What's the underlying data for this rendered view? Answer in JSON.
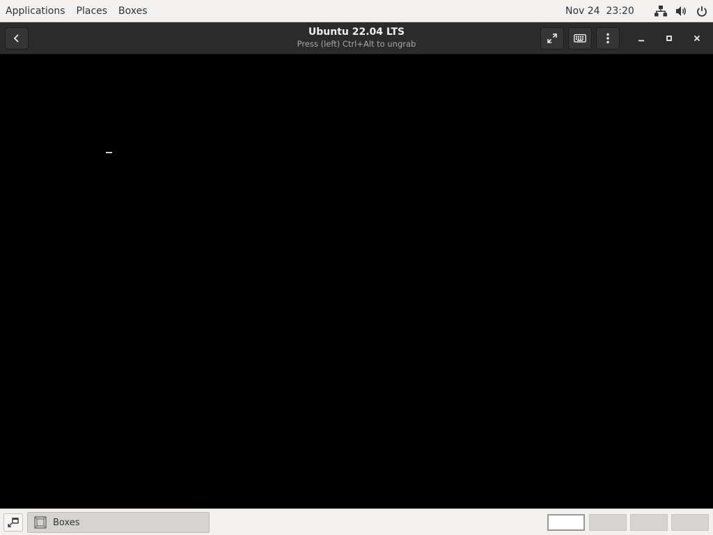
{
  "top_panel": {
    "menu": [
      "Applications",
      "Places",
      "Boxes"
    ],
    "clock": "Nov 24  23:20",
    "tray_icons": [
      "network-icon",
      "volume-icon",
      "power-icon"
    ]
  },
  "headerbar": {
    "title": "Ubuntu 22.04 LTS",
    "subtitle": "Press (left) Ctrl+Alt to ungrab",
    "buttons": [
      "back-icon",
      "fullscreen-icon",
      "keyboard-icon",
      "menu-dots-icon"
    ],
    "window_controls": [
      "minimize-icon",
      "maximize-icon",
      "close-icon"
    ]
  },
  "guest_display": {
    "cursor": "_"
  },
  "bottom_panel": {
    "task_label": "Boxes",
    "workspace_count": 4,
    "active_workspace": 1
  },
  "colors": {
    "panel_bg": "#f2f1f0",
    "headerbar_bg": "#2b2b2b",
    "display_bg": "#000000"
  }
}
